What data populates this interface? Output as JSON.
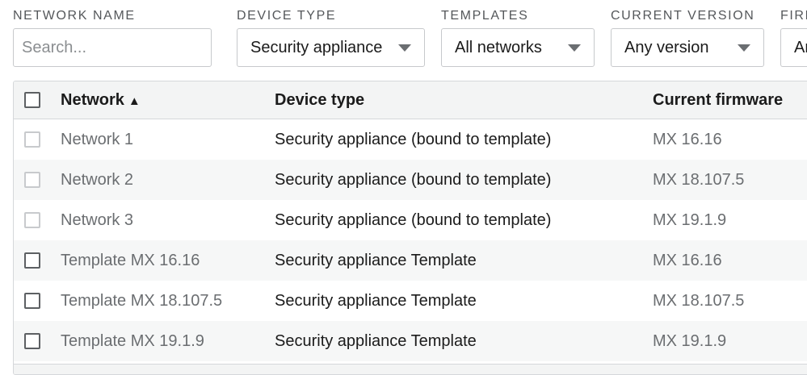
{
  "filters": {
    "network_name": {
      "label": "NETWORK NAME",
      "placeholder": "Search..."
    },
    "device_type": {
      "label": "DEVICE TYPE",
      "value": "Security appliance"
    },
    "templates": {
      "label": "TEMPLATES",
      "value": "All networks"
    },
    "current_version": {
      "label": "CURRENT VERSION",
      "value": "Any version"
    },
    "firmware": {
      "label": "FIRM",
      "value": "Ar"
    }
  },
  "table": {
    "headers": {
      "network": "Network",
      "sort_indicator": "▲",
      "device_type": "Device type",
      "current_firmware": "Current firmware"
    },
    "rows": [
      {
        "network": "Network 1",
        "device_type": "Security appliance (bound to template)",
        "firmware": "MX 16.16",
        "checkbox_enabled": false
      },
      {
        "network": "Network 2",
        "device_type": "Security appliance (bound to template)",
        "firmware": "MX 18.107.5",
        "checkbox_enabled": false
      },
      {
        "network": "Network 3",
        "device_type": "Security appliance (bound to template)",
        "firmware": "MX 19.1.9",
        "checkbox_enabled": false
      },
      {
        "network": "Template MX 16.16",
        "device_type": "Security appliance Template",
        "firmware": "MX 16.16",
        "checkbox_enabled": true
      },
      {
        "network": "Template MX 18.107.5",
        "device_type": "Security appliance Template",
        "firmware": "MX 18.107.5",
        "checkbox_enabled": true
      },
      {
        "network": "Template MX 19.1.9",
        "device_type": "Security appliance Template",
        "firmware": "MX 19.1.9",
        "checkbox_enabled": true
      }
    ]
  }
}
